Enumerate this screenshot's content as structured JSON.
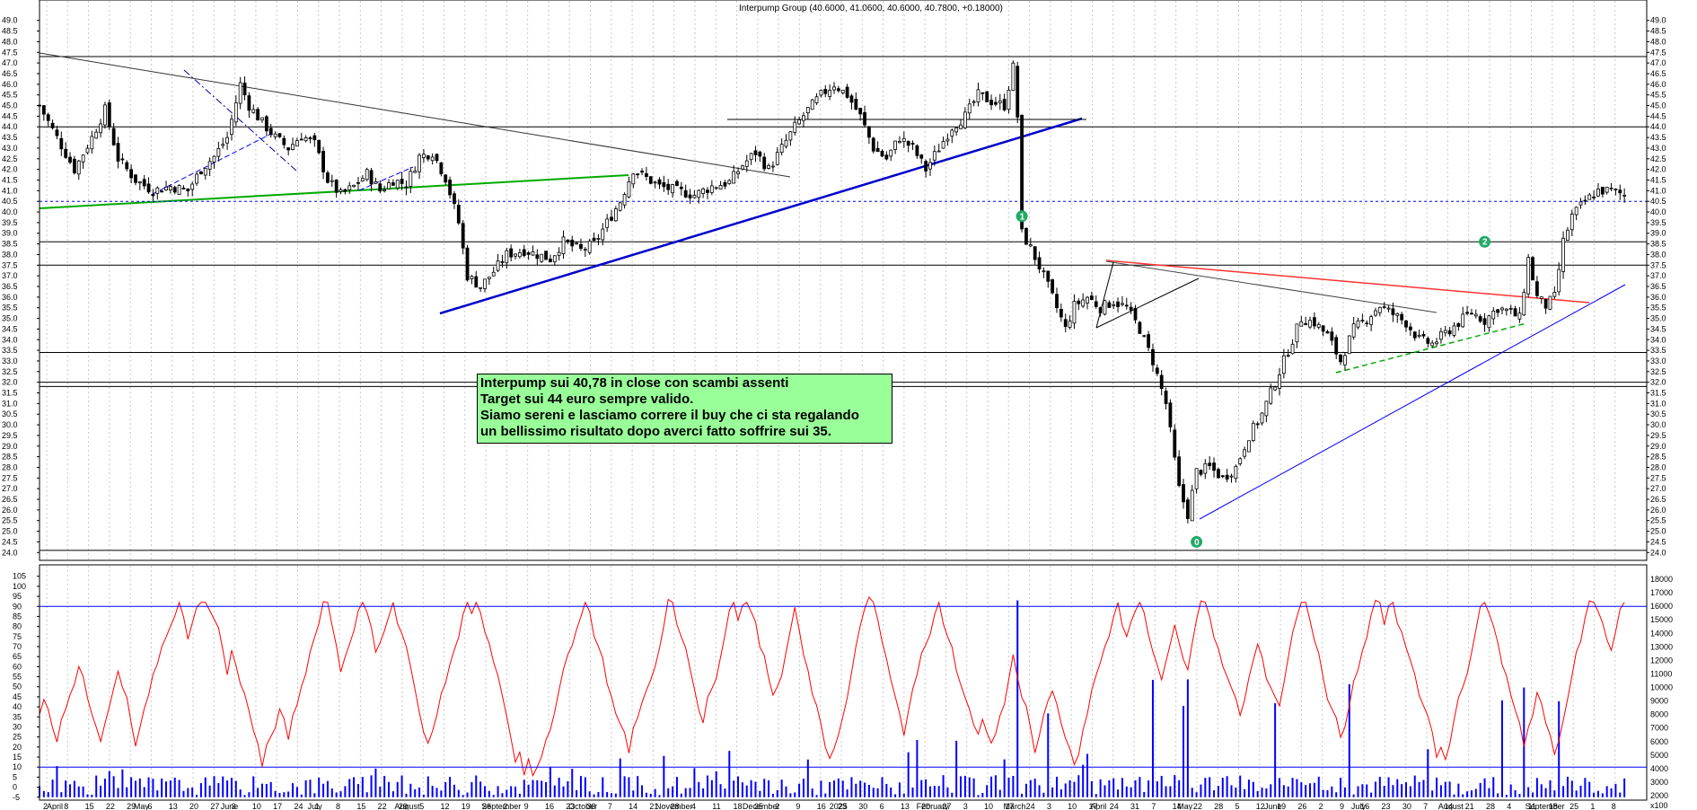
{
  "chart_data": {
    "title": "Interpump Group (40.6000, 41.0600, 40.6000, 40.7800, +0.18000)",
    "price_panel": {
      "type": "candlestick",
      "ylim": [
        23.8,
        49.2
      ],
      "y_ticks": [
        "24.0",
        "24.5",
        "25.0",
        "25.5",
        "26.0",
        "26.5",
        "27.0",
        "27.5",
        "28.0",
        "28.5",
        "29.0",
        "29.5",
        "30.0",
        "30.5",
        "31.0",
        "31.5",
        "32.0",
        "32.5",
        "33.0",
        "33.5",
        "34.0",
        "34.5",
        "35.0",
        "35.5",
        "36.0",
        "36.5",
        "37.0",
        "37.5",
        "38.0",
        "38.5",
        "39.0",
        "39.5",
        "40.0",
        "40.5",
        "41.0",
        "41.5",
        "42.0",
        "42.5",
        "43.0",
        "43.5",
        "44.0",
        "44.5",
        "45.0",
        "45.5",
        "46.0",
        "46.5",
        "47.0",
        "47.5",
        "48.0",
        "48.5",
        "49.0"
      ],
      "horizontal_levels": [
        47.3,
        44.0,
        38.6,
        37.5,
        33.4,
        32.0,
        31.8,
        24.1
      ],
      "reference_level": 40.5,
      "close_path": [
        [
          0,
          45.0
        ],
        [
          4,
          43.5
        ],
        [
          8,
          42.0
        ],
        [
          12,
          43.5
        ],
        [
          15,
          44.8
        ],
        [
          18,
          42.5
        ],
        [
          22,
          41.5
        ],
        [
          26,
          41.0
        ],
        [
          30,
          41.2
        ],
        [
          34,
          41.0
        ],
        [
          37,
          42.0
        ],
        [
          40,
          42.6
        ],
        [
          43,
          43.5
        ],
        [
          46,
          46.0
        ],
        [
          48,
          45.0
        ],
        [
          51,
          44.2
        ],
        [
          54,
          43.5
        ],
        [
          57,
          43.0
        ],
        [
          60,
          43.6
        ],
        [
          63,
          43.2
        ],
        [
          66,
          41.5
        ],
        [
          69,
          40.8
        ],
        [
          72,
          41.2
        ],
        [
          75,
          41.8
        ],
        [
          78,
          41.0
        ],
        [
          81,
          41.5
        ],
        [
          84,
          41.3
        ],
        [
          87,
          42.6
        ],
        [
          90,
          42.8
        ],
        [
          93,
          41.6
        ],
        [
          96,
          39.5
        ],
        [
          98,
          37.0
        ],
        [
          101,
          36.5
        ],
        [
          104,
          37.2
        ],
        [
          107,
          38.0
        ],
        [
          111,
          38.2
        ],
        [
          114,
          38.0
        ],
        [
          117,
          37.8
        ],
        [
          120,
          38.6
        ],
        [
          124,
          38.2
        ],
        [
          127,
          38.5
        ],
        [
          130,
          39.5
        ],
        [
          133,
          40.5
        ],
        [
          136,
          42.0
        ],
        [
          139,
          41.6
        ],
        [
          142,
          41.2
        ],
        [
          146,
          41.0
        ],
        [
          150,
          40.8
        ],
        [
          154,
          41.2
        ],
        [
          158,
          41.4
        ],
        [
          161,
          42.2
        ],
        [
          164,
          42.8
        ],
        [
          167,
          42.0
        ],
        [
          170,
          43.0
        ],
        [
          173,
          44.0
        ],
        [
          176,
          44.8
        ],
        [
          179,
          45.5
        ],
        [
          182,
          46.0
        ],
        [
          185,
          45.5
        ],
        [
          188,
          44.5
        ],
        [
          191,
          43.0
        ],
        [
          194,
          42.5
        ],
        [
          197,
          43.5
        ],
        [
          200,
          43.0
        ],
        [
          203,
          42.0
        ],
        [
          206,
          43.0
        ],
        [
          209,
          44.0
        ],
        [
          212,
          44.5
        ],
        [
          215,
          45.5
        ],
        [
          218,
          45.2
        ],
        [
          221,
          45.0
        ],
        [
          223,
          46.8
        ],
        [
          224,
          44.5
        ],
        [
          225,
          39.0
        ],
        [
          227,
          38.3
        ],
        [
          230,
          37.0
        ],
        [
          233,
          35.5
        ],
        [
          235,
          34.5
        ],
        [
          237,
          35.6
        ],
        [
          240,
          36.0
        ],
        [
          243,
          35.5
        ],
        [
          246,
          35.8
        ],
        [
          249,
          35.5
        ],
        [
          252,
          34.5
        ],
        [
          255,
          33.0
        ],
        [
          258,
          31.0
        ],
        [
          261,
          27.0
        ],
        [
          263,
          25.8
        ],
        [
          265,
          27.8
        ],
        [
          268,
          28.0
        ],
        [
          271,
          27.5
        ],
        [
          274,
          28.0
        ],
        [
          277,
          29.5
        ],
        [
          280,
          30.5
        ],
        [
          283,
          32.0
        ],
        [
          286,
          33.5
        ],
        [
          289,
          35.0
        ],
        [
          292,
          34.8
        ],
        [
          295,
          34.2
        ],
        [
          298,
          33.0
        ],
        [
          301,
          34.5
        ],
        [
          304,
          35.0
        ],
        [
          307,
          35.6
        ],
        [
          310,
          35.2
        ],
        [
          313,
          34.8
        ],
        [
          316,
          34.0
        ],
        [
          319,
          33.8
        ],
        [
          322,
          34.3
        ],
        [
          325,
          34.8
        ],
        [
          328,
          35.3
        ],
        [
          331,
          34.9
        ],
        [
          334,
          35.5
        ],
        [
          337,
          35.3
        ],
        [
          339,
          35.0
        ],
        [
          341,
          37.8
        ],
        [
          343,
          36.0
        ],
        [
          345,
          35.6
        ],
        [
          347,
          36.0
        ],
        [
          349,
          38.6
        ],
        [
          351,
          39.8
        ],
        [
          354,
          40.5
        ],
        [
          357,
          41.0
        ],
        [
          360,
          41.0
        ],
        [
          363,
          40.8
        ]
      ],
      "markers": [
        {
          "label": "1",
          "x": 225,
          "y": 39.8
        },
        {
          "label": "2",
          "x": 331,
          "y": 38.6
        },
        {
          "label": "0",
          "x": 265,
          "y": 24.5
        }
      ]
    },
    "oscillator_panel": {
      "type": "line+bar",
      "ylim": [
        -6,
        108
      ],
      "left_ticks": [
        "-5",
        "0",
        "5",
        "10",
        "15",
        "20",
        "25",
        "30",
        "35",
        "40",
        "45",
        "50",
        "55",
        "60",
        "65",
        "70",
        "75",
        "80",
        "85",
        "90",
        "95",
        "100",
        "105"
      ],
      "right_ticks": [
        "2000",
        "3000",
        "4000",
        "5000",
        "6000",
        "7000",
        "8000",
        "9000",
        "10000",
        "11000",
        "12000",
        "13000",
        "14000",
        "15000",
        "16000",
        "17000",
        "18000"
      ],
      "right_units": "x100",
      "levels": [
        90,
        10
      ],
      "oscillator_color": "#ff0000",
      "volume_color": "#0000ff"
    },
    "x_axis": {
      "days": [
        "2",
        "8",
        "15",
        "22",
        "29",
        "6",
        "13",
        "20",
        "27",
        "3",
        "10",
        "17",
        "24",
        "1",
        "8",
        "15",
        "22",
        "29",
        "5",
        "12",
        "19",
        "26",
        "2",
        "9",
        "16",
        "23",
        "30",
        "7",
        "14",
        "21",
        "28",
        "4",
        "11",
        "18",
        "25",
        "2",
        "9",
        "16",
        "23",
        "30",
        "6",
        "13",
        "20",
        "27",
        "3",
        "10",
        "17",
        "24",
        "3",
        "10",
        "17",
        "24",
        "31",
        "7",
        "14",
        "22",
        "28",
        "5",
        "12",
        "19",
        "26",
        "2",
        "9",
        "16",
        "23",
        "30",
        "7",
        "14",
        "21",
        "28",
        "4",
        "11",
        "18",
        "25",
        "1",
        "8"
      ],
      "months": [
        "April",
        "May",
        "June",
        "July",
        "August",
        "September",
        "October",
        "November",
        "December",
        "2025",
        "February",
        "March",
        "April",
        "May",
        "June",
        "July",
        "August",
        "September"
      ]
    }
  },
  "annotation": {
    "lines": [
      "Interpump sui 40,78 in close con scambi assenti",
      "Target sui 44 euro sempre valido.",
      "Siamo sereni e lasciamo correre il buy che ci sta regalando",
      "un bellissimo risultato dopo averci fatto soffrire sui 35."
    ]
  }
}
